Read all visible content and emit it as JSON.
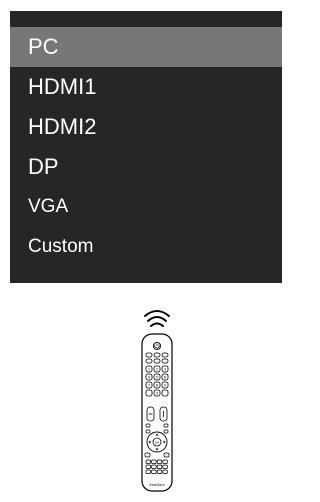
{
  "menu": {
    "items": [
      {
        "label": "PC",
        "selected": true
      },
      {
        "label": "HDMI1",
        "selected": false
      },
      {
        "label": "HDMI2",
        "selected": false
      },
      {
        "label": "DP",
        "selected": false
      },
      {
        "label": "VGA",
        "selected": false
      },
      {
        "label": "Custom",
        "selected": false
      }
    ]
  },
  "remote": {
    "brand": "ViewSonic",
    "keypad": [
      "1",
      "2",
      "3",
      "4",
      "5",
      "6",
      "7",
      "8",
      "9",
      "",
      "0",
      ""
    ],
    "ok_label": "OK"
  },
  "colors": {
    "menu_bg": "#262626",
    "selected_bg": "#777777",
    "text": "#ffffff"
  }
}
